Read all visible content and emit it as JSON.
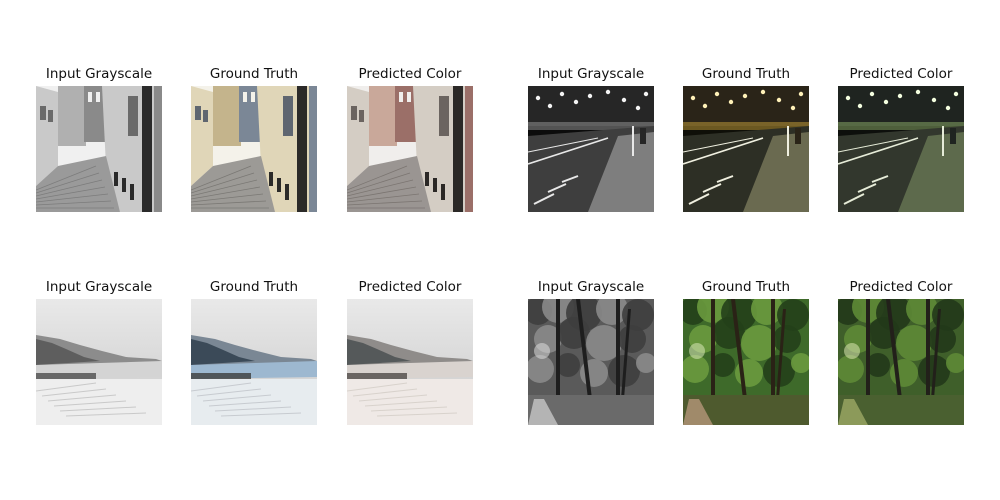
{
  "figure": {
    "panels": [
      {
        "title": "Input Grayscale",
        "scene": "street",
        "mode": "gray"
      },
      {
        "title": "Ground Truth",
        "scene": "street",
        "mode": "color"
      },
      {
        "title": "Predicted Color",
        "scene": "street",
        "mode": "pred"
      },
      {
        "title": "Input Grayscale",
        "scene": "night-road",
        "mode": "gray"
      },
      {
        "title": "Ground Truth",
        "scene": "night-road",
        "mode": "color"
      },
      {
        "title": "Predicted Color",
        "scene": "night-road",
        "mode": "pred"
      },
      {
        "title": "Input Grayscale",
        "scene": "mountain-lake",
        "mode": "gray"
      },
      {
        "title": "Ground Truth",
        "scene": "mountain-lake",
        "mode": "color"
      },
      {
        "title": "Predicted Color",
        "scene": "mountain-lake",
        "mode": "pred"
      },
      {
        "title": "Input Grayscale",
        "scene": "forest",
        "mode": "gray"
      },
      {
        "title": "Ground Truth",
        "scene": "forest",
        "mode": "color"
      },
      {
        "title": "Predicted Color",
        "scene": "forest",
        "mode": "pred"
      }
    ]
  }
}
